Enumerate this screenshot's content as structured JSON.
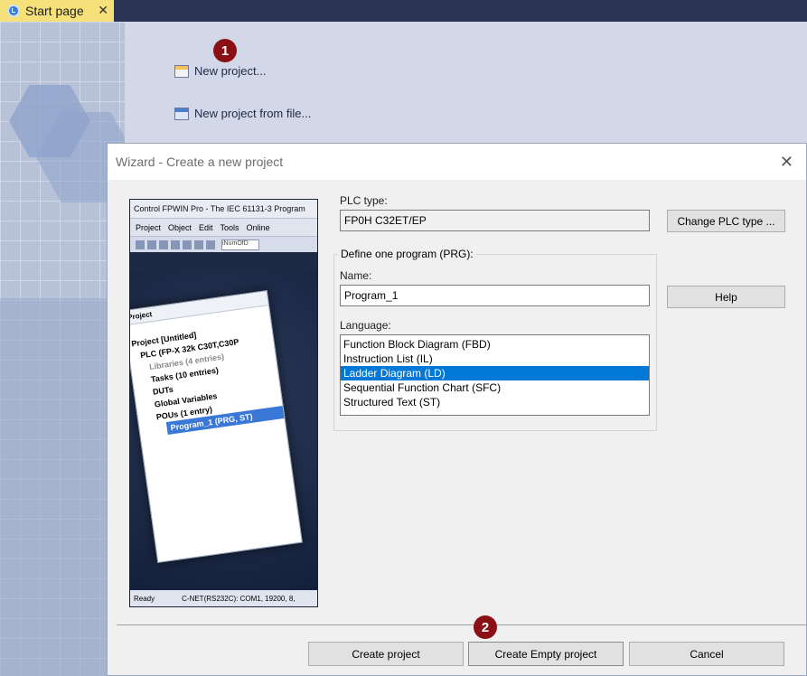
{
  "tab": {
    "label": "Start page",
    "close": "✕"
  },
  "start_page": {
    "new_project": "New project...",
    "new_project_from_file": "New project from file..."
  },
  "badges": {
    "one": "1",
    "two": "2"
  },
  "wizard": {
    "title": "Wizard - Create a new project",
    "close": "✕",
    "plc_type_label": "PLC type:",
    "plc_type_value": "FP0H C32ET/EP",
    "change_plc_button": "Change PLC type ...",
    "define_program_legend": "Define one program (PRG):",
    "name_label": "Name:",
    "name_value": "Program_1",
    "help_button": "Help",
    "language_label": "Language:",
    "languages": [
      "Function Block Diagram (FBD)",
      "Instruction List (IL)",
      "Ladder Diagram (LD)",
      "Sequential Function Chart (SFC)",
      "Structured Text (ST)"
    ],
    "selected_language": "Ladder Diagram (LD)",
    "buttons": {
      "create_project": "Create project",
      "create_empty_project": "Create Empty project",
      "cancel": "Cancel"
    },
    "preview": {
      "title": "Control FPWIN Pro - The IEC 61131-3 Program",
      "menu": [
        "Project",
        "Object",
        "Edit",
        "Tools",
        "Online"
      ],
      "toolbar_input": "iNumOfD",
      "tree_title": "Project",
      "tree": [
        "Project [Untitled]",
        "PLC (FP-X 32k C30T,C30P",
        "Libraries (4 entries)",
        "Tasks (10 entries)",
        "DUTs",
        "Global Variables",
        "POUs (1 entry)",
        "Program_1 (PRG, ST)"
      ],
      "status_left": "Ready",
      "status_right": "C-NET(RS232C): COM1, 19200, 8,"
    }
  }
}
